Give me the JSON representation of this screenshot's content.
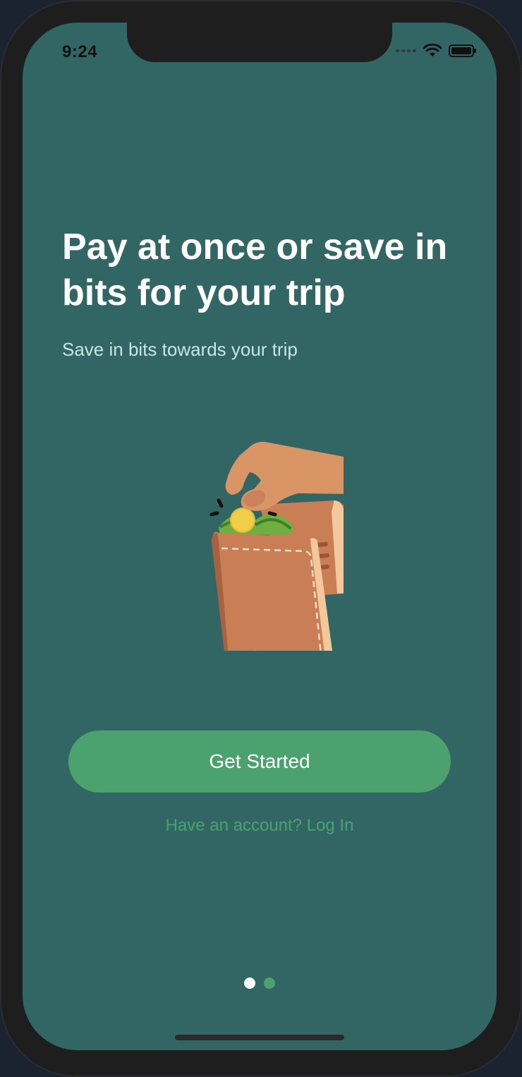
{
  "status_bar": {
    "time": "9:24"
  },
  "onboarding": {
    "title": "Pay at once or save in bits for your trip",
    "subtitle": "Save in bits towards your trip",
    "primary_button": "Get Started",
    "login_link": "Have an account? Log In"
  },
  "pagination": {
    "total": 2,
    "active_index": 0
  },
  "icons": [
    "wifi-icon",
    "battery-icon",
    "cellular-signal-icon",
    "wallet-coin-illustration"
  ],
  "colors": {
    "screen_bg": "#316664",
    "accent": "#4ba26f",
    "title": "#ffffff",
    "subtitle": "#c8e6e2"
  }
}
